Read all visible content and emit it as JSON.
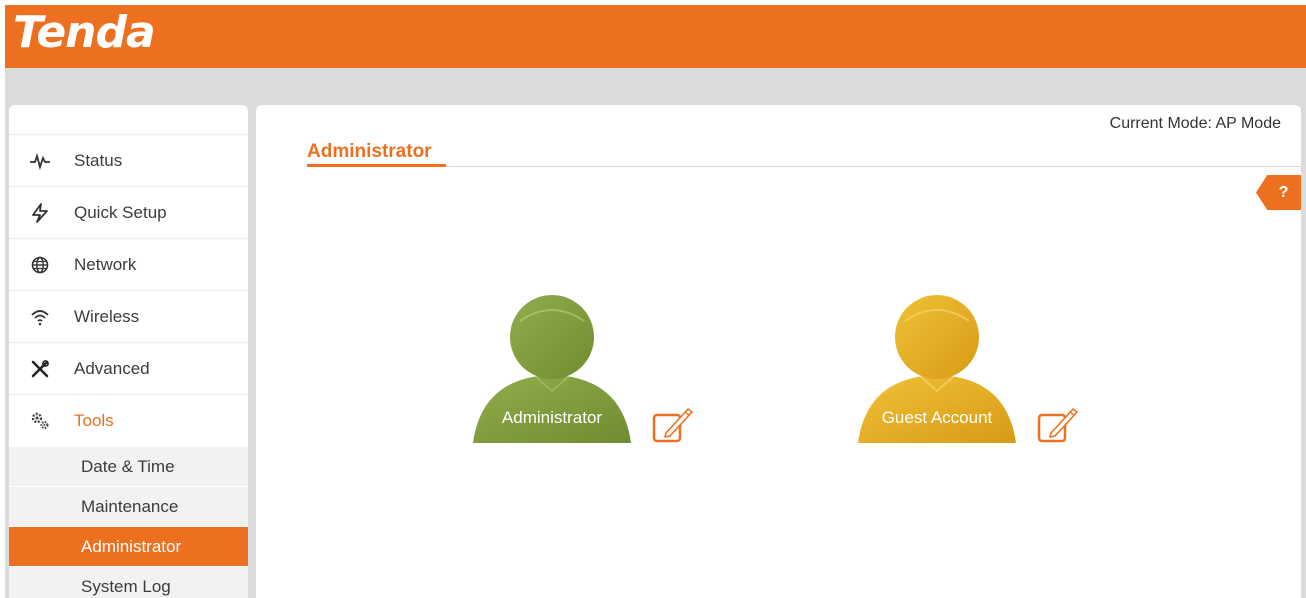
{
  "header": {
    "logo_text": "Tenda",
    "brand_color": "#ed7020"
  },
  "sidebar": {
    "items": [
      {
        "label": "Status",
        "icon": "pulse-icon"
      },
      {
        "label": "Quick Setup",
        "icon": "lightning-icon"
      },
      {
        "label": "Network",
        "icon": "globe-icon"
      },
      {
        "label": "Wireless",
        "icon": "wifi-icon"
      },
      {
        "label": "Advanced",
        "icon": "tools-icon"
      },
      {
        "label": "Tools",
        "icon": "gears-icon",
        "active": true
      }
    ],
    "submenu": [
      {
        "label": "Date & Time"
      },
      {
        "label": "Maintenance"
      },
      {
        "label": "Administrator",
        "active": true
      },
      {
        "label": "System Log"
      }
    ]
  },
  "main": {
    "mode_text": "Current Mode: AP Mode",
    "title": "Administrator",
    "help_label": "?",
    "accounts": [
      {
        "label": "Administrator",
        "color": "#7a9a3a",
        "icon": "user-avatar-icon"
      },
      {
        "label": "Guest Account",
        "color": "#e2a91e",
        "icon": "user-avatar-icon"
      }
    ]
  }
}
